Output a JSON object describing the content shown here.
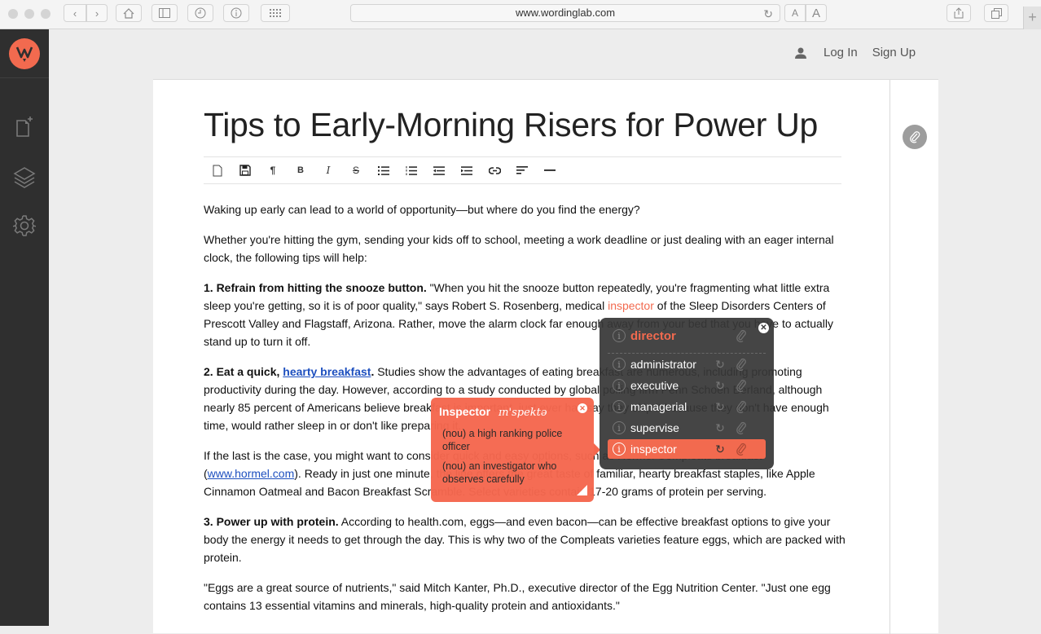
{
  "browser": {
    "url": "www.wordinglab.com",
    "buttons": [
      "back",
      "forward",
      "home",
      "sidebar",
      "history",
      "info",
      "grid"
    ],
    "font_small": "A",
    "font_large": "A"
  },
  "topnav": {
    "login": "Log In",
    "signup": "Sign Up"
  },
  "sidebar": {
    "items": [
      {
        "name": "new-document",
        "icon": "new-document-icon"
      },
      {
        "name": "layers",
        "icon": "layers-icon"
      },
      {
        "name": "settings",
        "icon": "gear-icon"
      }
    ]
  },
  "document": {
    "title": "Tips to Early-Morning Risers for Power Up",
    "toolbar": [
      "new",
      "save",
      "paragraph",
      "bold",
      "italic",
      "strikethrough",
      "bulleted-list",
      "numbered-list",
      "outdent",
      "indent",
      "link",
      "align-left",
      "horizontal-rule"
    ],
    "paragraphs": {
      "p1": "Waking up early can lead to a world of opportunity—but where do you find the energy?",
      "p2": "Whether you're hitting the gym, sending your kids off to school, meeting a work deadline or just dealing with an eager internal clock, the following tips will help:",
      "p3_bold": "1. Refrain from hitting the snooze button.",
      "p3_a": " \"When you hit the snooze button repeatedly, you're fragmenting what little extra sleep you're getting, so it is of poor quality,\" says Robert S. Rosenberg, medical ",
      "p3_highlight": "inspector",
      "p3_b": " of the Sleep Disorders Centers of Prescott Valley and Flagstaff, Arizona. Rather, move the alarm clock far enough away from your bed that you have to actually stand up to turn it off.",
      "p4_bold": "2. Eat a quick, ",
      "p4_link": "hearty breakfast",
      "p4_bold2": ".",
      "p4_a": " Studies show the advantages of eating breakfast are numerous, including promoting productivity during the day. However, according to a study conducted by global polling firm Penn Schoen Berland, although nearly 85 percent of Americans believe breakfast is important, just ever half say they skip it because they don't have enough time, would rather sleep in or don't like preparing it.",
      "p5_a": "If the last is the case, you might want to consider quick and easy options, such as Hormel Compleats breakfast (",
      "p5_link": "www.hormel.com",
      "p5_b": "). Ready in just one minute, the line offers the great taste of familiar, hearty breakfast staples, like Apple Cinnamon Oatmeal and Bacon Breakfast Scramble. Select varieties contain 17-20 grams of protein per serving.",
      "p6_bold": "3. Power up with protein.",
      "p6_a": " According to health.com, eggs—and even bacon—can be effective breakfast options to give your body the energy it needs to get through the day. This is why two of the Compleats varieties feature eggs, which are packed with protein.",
      "p7": "\"Eggs are a great source of nutrients,\" said Mitch Kanter, Ph.D., executive director of the Egg Nutrition Center. \"Just one egg contains 13 essential vitamins and minerals, high-quality protein and antioxidants.\""
    }
  },
  "synonym_popup": {
    "header": "director",
    "options": [
      {
        "word": "administrator",
        "selected": false
      },
      {
        "word": "executive",
        "selected": false
      },
      {
        "word": "managerial",
        "selected": false
      },
      {
        "word": "supervise",
        "selected": false
      },
      {
        "word": "inspector",
        "selected": true
      }
    ],
    "accent": "#f26a4f"
  },
  "definition_popup": {
    "word": "Inspector",
    "pronunciation": "ɪn'spektə",
    "definitions": [
      "(nou) a high ranking police officer",
      "(nou) an investigator who observes carefully"
    ]
  },
  "colors": {
    "brand": "#f26a4f",
    "sidebar": "#2f2f2f",
    "link": "#1d4fbf"
  }
}
